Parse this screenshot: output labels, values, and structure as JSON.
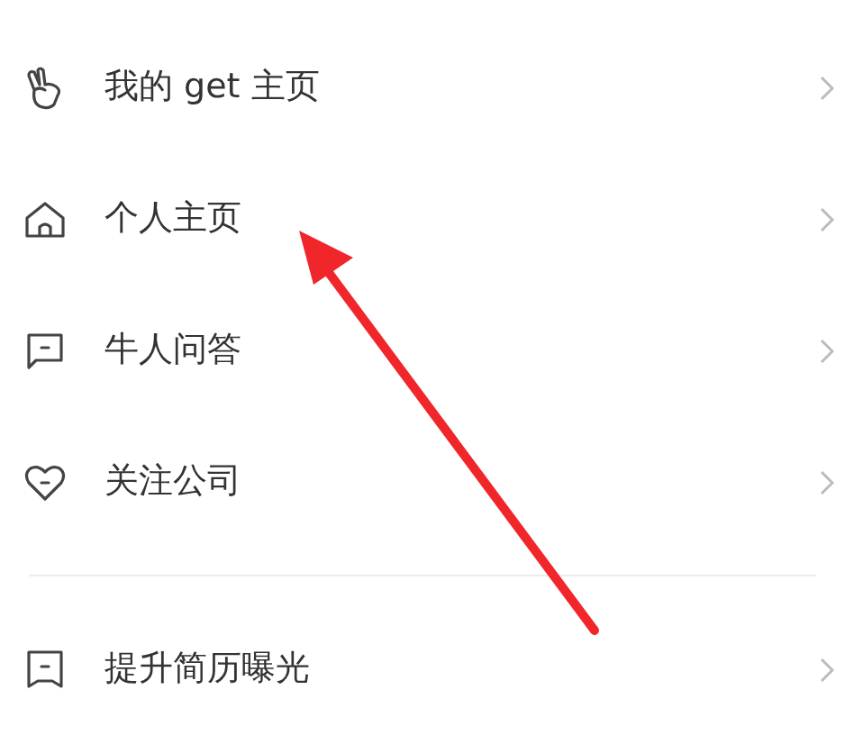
{
  "sections": [
    {
      "items": [
        {
          "kind": "hand",
          "label": "我的 get 主页"
        },
        {
          "kind": "home",
          "label": "个人主页"
        },
        {
          "kind": "chat",
          "label": "牛人问答"
        },
        {
          "kind": "heart",
          "label": "关注公司"
        }
      ]
    },
    {
      "items": [
        {
          "kind": "bookmark",
          "label": "提升简历曝光"
        }
      ]
    }
  ]
}
